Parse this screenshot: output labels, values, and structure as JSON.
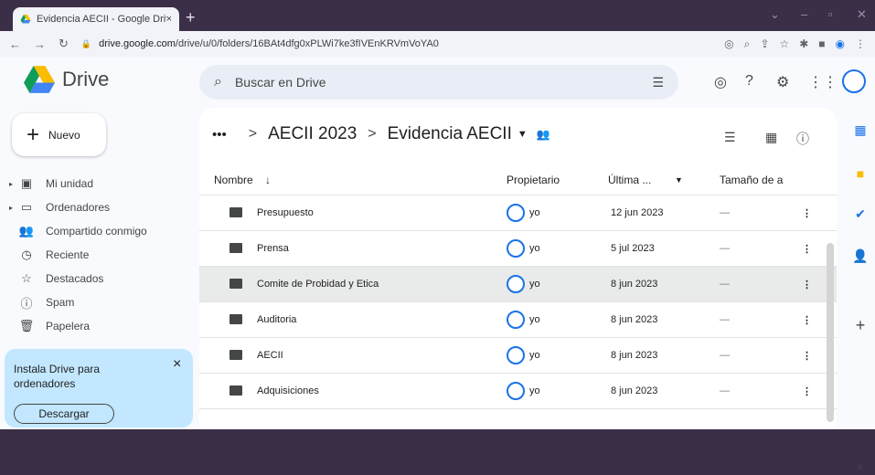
{
  "browser": {
    "tab_title": "Evidencia AECII - Google Drive",
    "tab_close": "×",
    "new_tab": "+",
    "url_host": "drive.google.com",
    "url_path": "/drive/u/0/folders/16BAt4dfg0xPLWi7ke3fIVEnKRVmVoYA0"
  },
  "app": {
    "name": "Drive",
    "search_placeholder": "Buscar en Drive",
    "new_label": "Nuevo",
    "new_icon": "+"
  },
  "sidebar": {
    "items": [
      {
        "label": "Mi unidad",
        "icon": "drive-icon"
      },
      {
        "label": "Ordenadores",
        "icon": "computer-icon"
      },
      {
        "label": "Compartido conmigo",
        "icon": "people-icon"
      },
      {
        "label": "Reciente",
        "icon": "clock-icon"
      },
      {
        "label": "Destacados",
        "icon": "star-icon"
      },
      {
        "label": "Spam",
        "icon": "spam-icon"
      },
      {
        "label": "Papelera",
        "icon": "trash-icon"
      }
    ]
  },
  "promo": {
    "text": "Instala Drive para ordenadores",
    "button": "Descargar",
    "close": "×"
  },
  "breadcrumb": {
    "dots": "•••",
    "parent": "AECII 2023",
    "current": "Evidencia AECII",
    "sep": ">"
  },
  "table": {
    "headers": {
      "name": "Nombre",
      "owner": "Propietario",
      "modified": "Última ...",
      "size": "Tamaño de a"
    },
    "rows": [
      {
        "name": "Presupuesto",
        "owner": "yo",
        "date": "12 jun 2023",
        "size": "—"
      },
      {
        "name": "Prensa",
        "owner": "yo",
        "date": "5 jul 2023",
        "size": "—"
      },
      {
        "name": "Comite de Probidad y Etica",
        "owner": "yo",
        "date": "8 jun 2023",
        "size": "—"
      },
      {
        "name": "Auditoria",
        "owner": "yo",
        "date": "8 jun 2023",
        "size": "—"
      },
      {
        "name": "AECII",
        "owner": "yo",
        "date": "8 jun 2023",
        "size": "—"
      },
      {
        "name": "Adquisiciones",
        "owner": "yo",
        "date": "8 jun 2023",
        "size": "—"
      }
    ],
    "selected_index": 2
  },
  "colors": {
    "accent": "#1a73e8",
    "promo_bg": "#c2e7ff",
    "frame": "#3a2f47"
  }
}
